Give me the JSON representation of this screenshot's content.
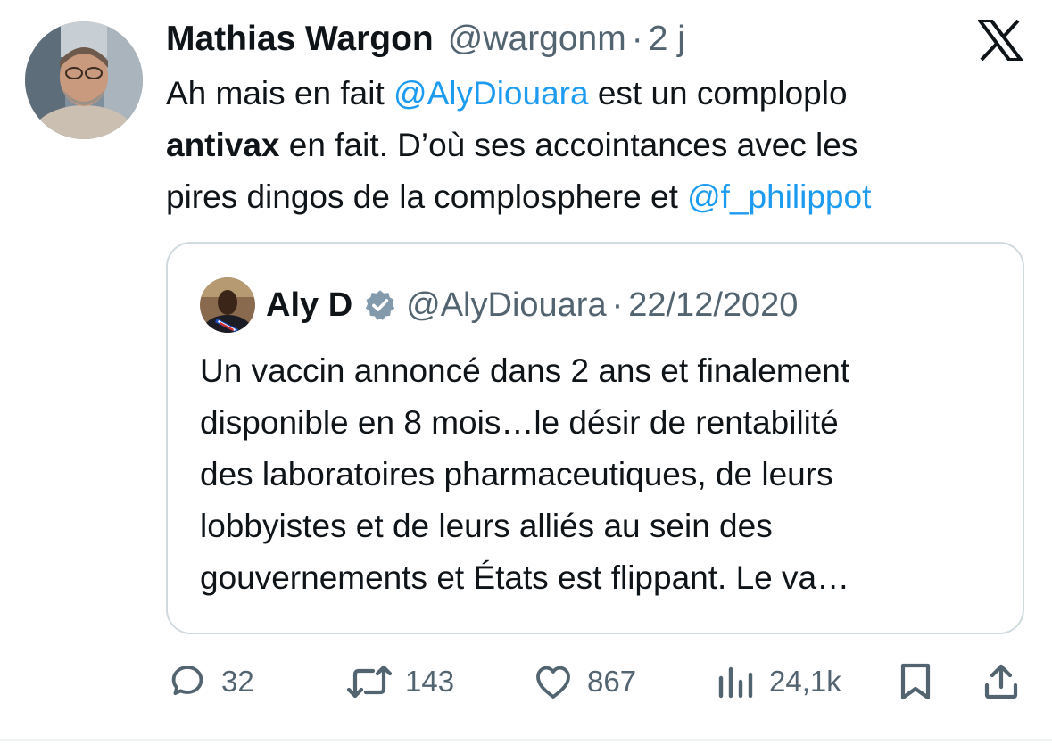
{
  "tweet": {
    "author_name": "Mathias Wargon",
    "author_handle": "@wargonm",
    "separator": "·",
    "time": "2 j",
    "text": {
      "l1_a": "Ah mais en fait ",
      "l1_mention": "@AlyDiouara",
      "l1_b": " est un comploplo",
      "l2_bold": "antivax",
      "l2_b": " en fait. D’où ses accointances avec les",
      "l3_a": "pires dingos de la complosphere et ",
      "l3_mention": "@f_philippot"
    }
  },
  "quoted": {
    "author_name": "Aly D",
    "author_handle": "@AlyDiouara",
    "separator": "·",
    "date": "22/12/2020",
    "lines": [
      "Un vaccin annoncé dans 2 ans et finalement",
      "disponible en 8 mois…le désir de rentabilité",
      "des laboratoires pharmaceutiques, de leurs",
      "lobbyistes et de leurs alliés au sein des",
      "gouvernements et États est flippant. Le va…"
    ]
  },
  "actions": {
    "replies": "32",
    "retweets": "143",
    "likes": "867",
    "views": "24,1k"
  },
  "colors": {
    "text": "#0f1419",
    "secondary": "#536471",
    "accent": "#1d9bf0",
    "border": "#cfd9de"
  },
  "icons": [
    "x-logo-icon",
    "verified-badge-icon",
    "reply-icon",
    "retweet-icon",
    "like-icon",
    "views-icon",
    "bookmark-icon",
    "share-icon"
  ]
}
